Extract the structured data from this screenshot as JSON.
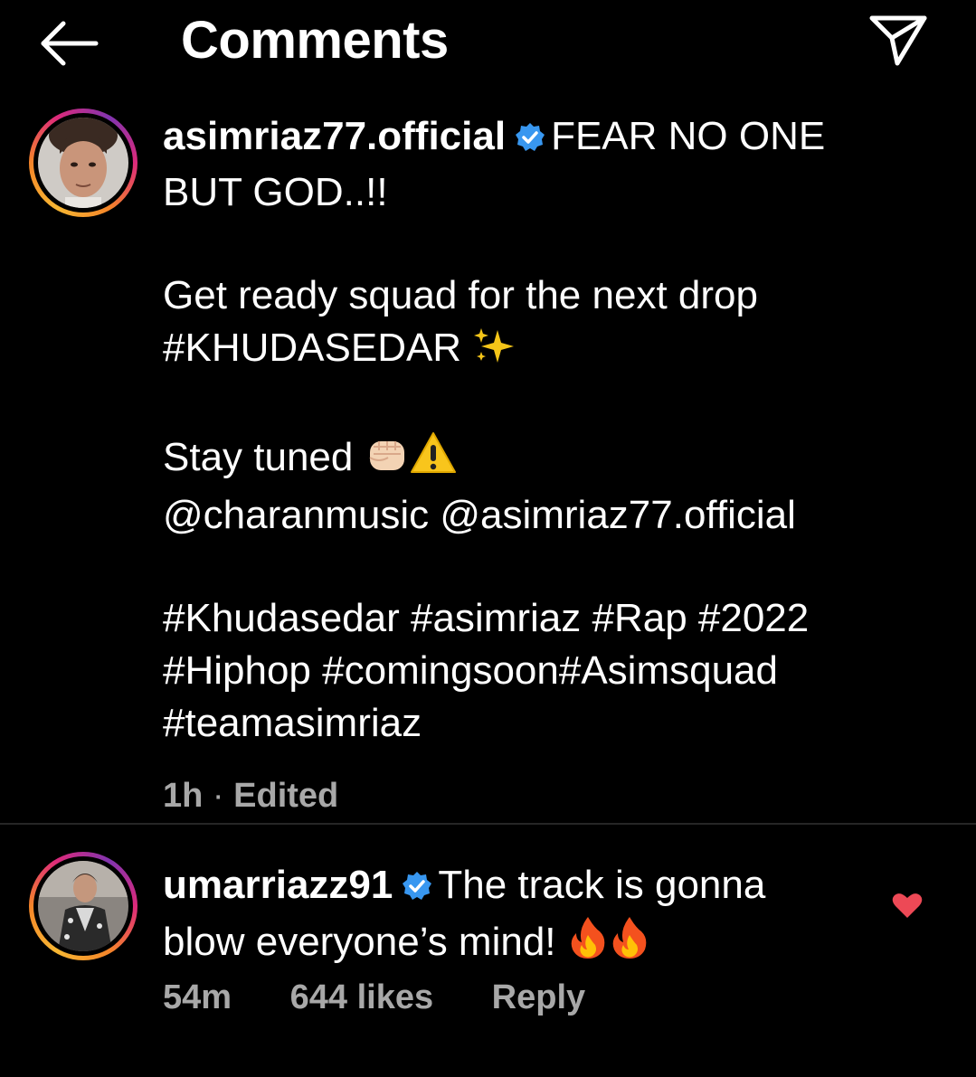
{
  "header": {
    "title": "Comments",
    "back_icon": "arrow-left-icon",
    "send_icon": "paper-plane-icon"
  },
  "post": {
    "username": "asimriaz77.official",
    "caption_line1": "FEAR NO ONE",
    "caption_line2": "BUT GOD..!!",
    "caption_line3": "Get ready squad for the next drop",
    "caption_line4": "#KHUDASEDAR",
    "caption_line5": "Stay tuned",
    "caption_line6": "@charanmusic @asimriaz77.official",
    "caption_line7": "#Khudasedar #asimriaz #Rap #2022",
    "caption_line8": "#Hiphop #comingsoon#Asimsquad",
    "caption_line9": "#teamasimriaz",
    "time": "1h",
    "separator": "·",
    "edited": "Edited"
  },
  "comment": {
    "username": "umarriazz91",
    "text_line1": "The track is gonna",
    "text_line2": "blow everyone’s mind!",
    "time": "54m",
    "likes": "644 likes",
    "reply": "Reply",
    "liked": true
  },
  "colors": {
    "background": "#000000",
    "text": "#ffffff",
    "muted": "#a8a8a8",
    "verified": "#3897f0",
    "heart": "#ed4956",
    "divider": "#262626"
  }
}
